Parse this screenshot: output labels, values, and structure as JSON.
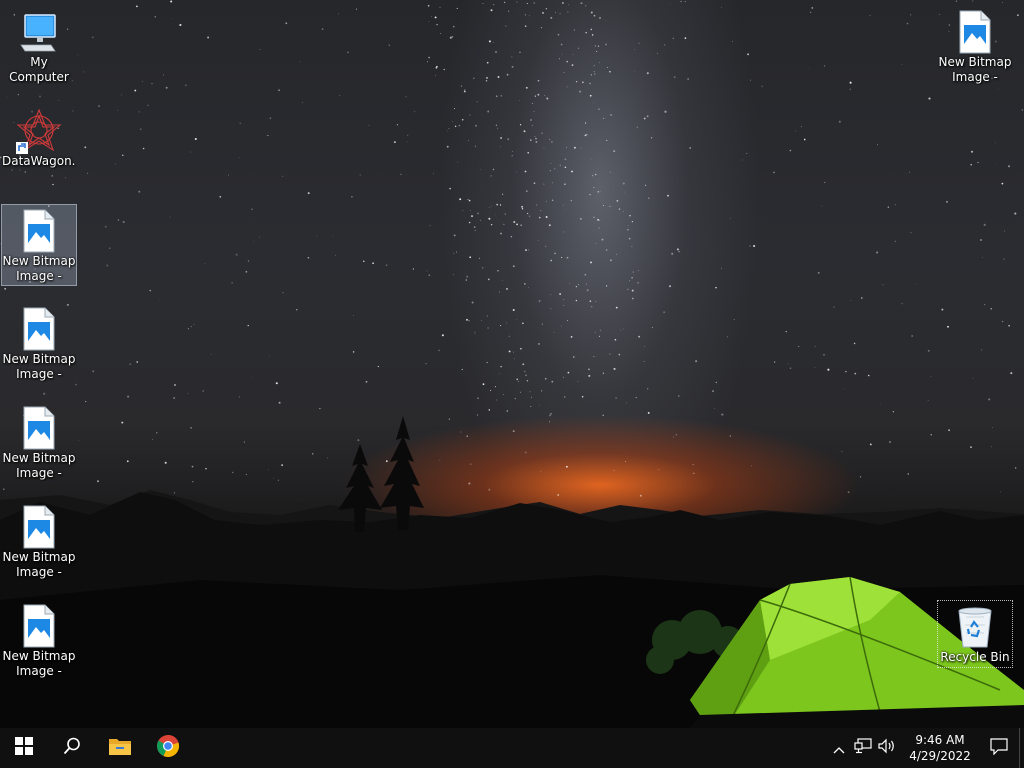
{
  "desktop": {
    "icons": [
      {
        "label": "My Computer",
        "type": "computer"
      },
      {
        "label": "DataWagon...",
        "type": "app-shortcut"
      },
      {
        "label": "New Bitmap Image - Copy",
        "type": "bitmap",
        "selected": true
      },
      {
        "label": "New Bitmap Image - Co...",
        "type": "bitmap"
      },
      {
        "label": "New Bitmap Image - Co...",
        "type": "bitmap"
      },
      {
        "label": "New Bitmap Image - Co...",
        "type": "bitmap"
      },
      {
        "label": "New Bitmap Image - Co...",
        "type": "bitmap"
      },
      {
        "label": "New Bitmap Image - Co...",
        "type": "bitmap"
      },
      {
        "label": "Recycle Bin",
        "type": "recycle-bin",
        "focused": true
      }
    ]
  },
  "taskbar": {
    "start_icon": "windows-start-icon",
    "search_icon": "search-icon",
    "pinned": [
      "file-explorer-icon",
      "chrome-icon"
    ],
    "tray": {
      "icons": [
        "chevron-up-icon",
        "network-icon",
        "volume-icon"
      ],
      "time": "9:46 AM",
      "date": "4/29/2022",
      "notification_icon": "action-center-icon"
    }
  },
  "colors": {
    "taskbar": "#101010",
    "tent_green": "#8fd62a",
    "horizon_glow": "#ff6e1e",
    "bitmap_blue": "#1e88e5",
    "start_blue": "#ffffff"
  }
}
